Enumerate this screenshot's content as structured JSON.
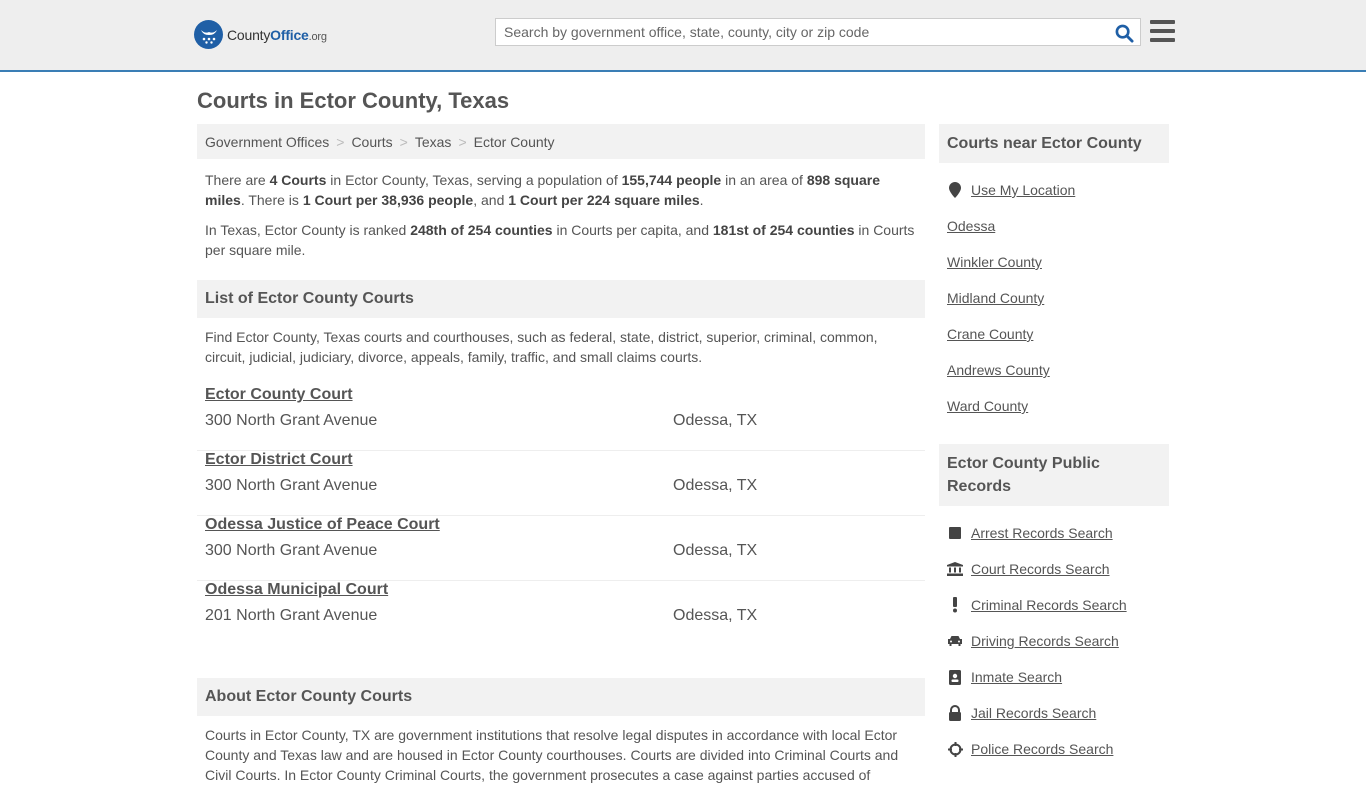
{
  "header": {
    "logo": {
      "brand_main": "County",
      "brand_bold": "Office",
      "brand_tld": ".org"
    },
    "search": {
      "placeholder": "Search by government office, state, county, city or zip code",
      "value": ""
    },
    "search_icon": "search-icon",
    "menu_icon": "hamburger-menu-icon"
  },
  "page": {
    "title": "Courts in Ector County, Texas"
  },
  "breadcrumb": {
    "items": [
      "Government Offices",
      "Courts",
      "Texas",
      "Ector County"
    ],
    "separator": ">"
  },
  "summary": {
    "p1": {
      "t1": "There are ",
      "b1": "4 Courts",
      "t2": " in Ector County, Texas, serving a population of ",
      "b2": "155,744 people",
      "t3": " in an area of ",
      "b3": "898 square miles",
      "t4": ". There is ",
      "b4": "1 Court per 38,936 people",
      "t5": ", and ",
      "b5": "1 Court per 224 square miles",
      "t6": "."
    },
    "p2": {
      "t1": "In Texas, Ector County is ranked ",
      "b1": "248th of 254 counties",
      "t2": " in Courts per capita, and ",
      "b2": "181st of 254 counties",
      "t3": " in Courts per square mile."
    }
  },
  "list_section": {
    "heading": "List of Ector County Courts",
    "intro": "Find Ector County, Texas courts and courthouses, such as federal, state, district, superior, criminal, common, circuit, judicial, judiciary, divorce, appeals, family, traffic, and small claims courts.",
    "courts": [
      {
        "name": "Ector County Court",
        "address": "300 North Grant Avenue",
        "city": "Odessa, TX"
      },
      {
        "name": "Ector District Court",
        "address": "300 North Grant Avenue",
        "city": "Odessa, TX"
      },
      {
        "name": "Odessa Justice of Peace Court",
        "address": "300 North Grant Avenue",
        "city": "Odessa, TX"
      },
      {
        "name": "Odessa Municipal Court",
        "address": "201 North Grant Avenue",
        "city": "Odessa, TX"
      }
    ]
  },
  "about_section": {
    "heading": "About Ector County Courts",
    "text": "Courts in Ector County, TX are government institutions that resolve legal disputes in accordance with local Ector County and Texas law and are housed in Ector County courthouses. Courts are divided into Criminal Courts and Civil Courts. In Ector County Criminal Courts, the government prosecutes a case against parties accused of"
  },
  "sidebar": {
    "near": {
      "heading": "Courts near Ector County",
      "use_location": {
        "label": "Use My Location",
        "icon": "map-marker-icon"
      },
      "links": [
        "Odessa",
        "Winkler County",
        "Midland County",
        "Crane County",
        "Andrews County",
        "Ward County"
      ]
    },
    "records": {
      "heading": "Ector County Public Records",
      "links": [
        {
          "label": "Arrest Records Search",
          "icon": "square-icon"
        },
        {
          "label": "Court Records Search",
          "icon": "courthouse-icon"
        },
        {
          "label": "Criminal Records Search",
          "icon": "exclamation-icon"
        },
        {
          "label": "Driving Records Search",
          "icon": "car-icon"
        },
        {
          "label": "Inmate Search",
          "icon": "id-badge-icon"
        },
        {
          "label": "Jail Records Search",
          "icon": "lock-icon"
        },
        {
          "label": "Police Records Search",
          "icon": "crosshairs-icon"
        }
      ]
    }
  }
}
